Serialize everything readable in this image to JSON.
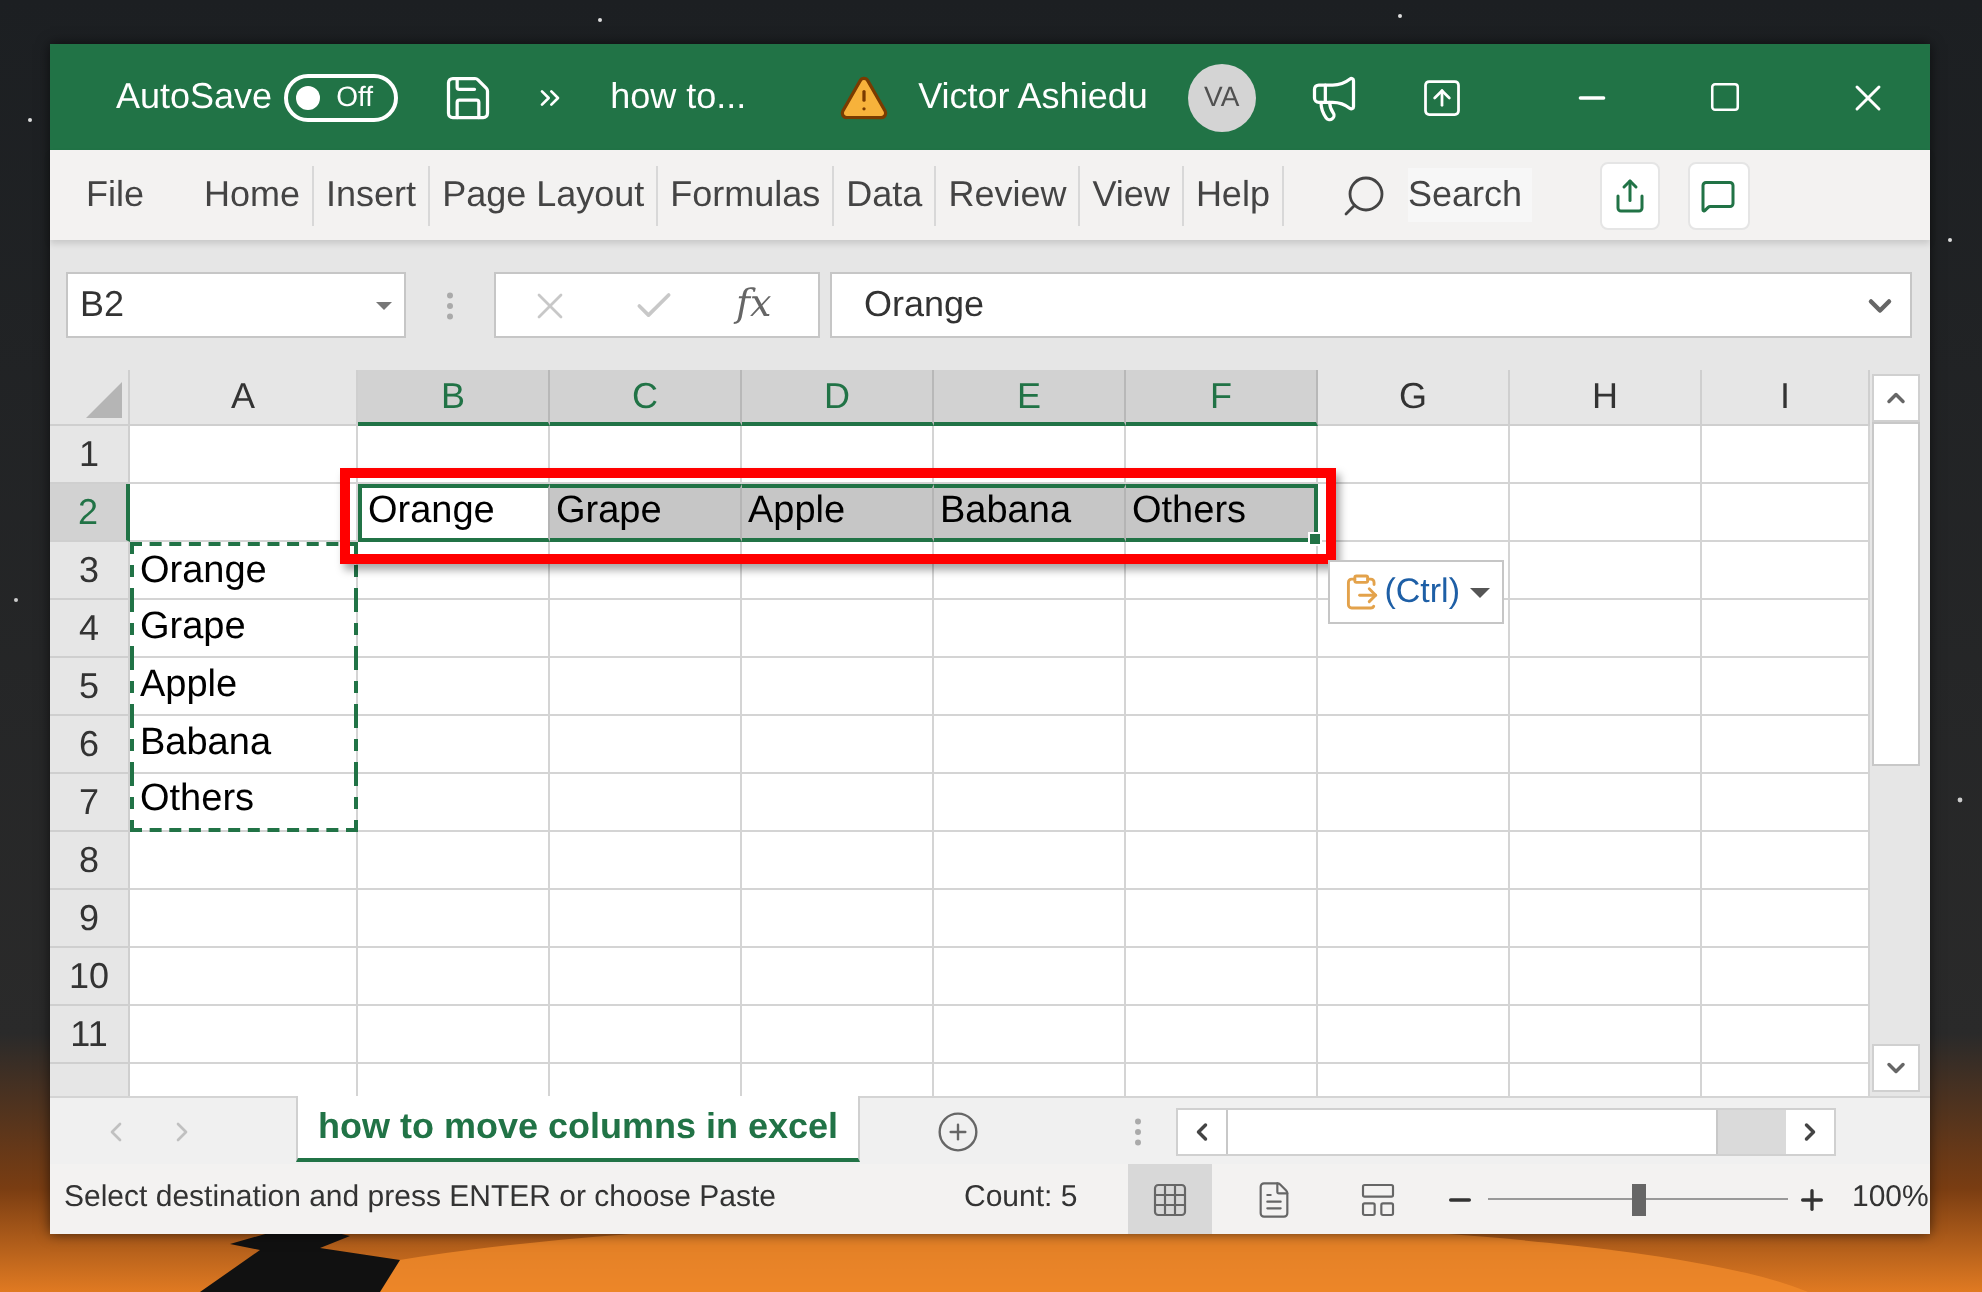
{
  "title_bar": {
    "autosave": {
      "label": "AutoSave",
      "state_label": "Off",
      "on": false
    },
    "document_title": "how to...",
    "user": {
      "name": "Victor Ashiedu",
      "initials": "VA"
    }
  },
  "ribbon_tabs": [
    "File",
    "Home",
    "Insert",
    "Page Layout",
    "Formulas",
    "Data",
    "Review",
    "View",
    "Help"
  ],
  "search": {
    "placeholder": "Search"
  },
  "formula_bar": {
    "name_box": "B2",
    "function_label": "fx",
    "value": "Orange"
  },
  "sheet": {
    "columns": [
      {
        "label": "A",
        "selected": false
      },
      {
        "label": "B",
        "selected": true
      },
      {
        "label": "C",
        "selected": true
      },
      {
        "label": "D",
        "selected": true
      },
      {
        "label": "E",
        "selected": true
      },
      {
        "label": "F",
        "selected": true
      },
      {
        "label": "G",
        "selected": false
      },
      {
        "label": "H",
        "selected": false
      },
      {
        "label": "I",
        "selected": false
      }
    ],
    "rows": [
      {
        "label": "1",
        "selected": false,
        "cells": {}
      },
      {
        "label": "2",
        "selected": true,
        "cells": {
          "B": {
            "text": "Orange",
            "selected": true,
            "active": true
          },
          "C": {
            "text": "Grape",
            "selected": true,
            "active": false
          },
          "D": {
            "text": "Apple",
            "selected": true,
            "active": false
          },
          "E": {
            "text": "Babana",
            "selected": true,
            "active": false
          },
          "F": {
            "text": "Others",
            "selected": true,
            "active": false
          }
        }
      },
      {
        "label": "3",
        "selected": false,
        "cells": {
          "A": {
            "text": "Orange",
            "copied": true
          }
        }
      },
      {
        "label": "4",
        "selected": false,
        "cells": {
          "A": {
            "text": "Grape",
            "copied": true
          }
        }
      },
      {
        "label": "5",
        "selected": false,
        "cells": {
          "A": {
            "text": "Apple",
            "copied": true
          }
        }
      },
      {
        "label": "6",
        "selected": false,
        "cells": {
          "A": {
            "text": "Babana",
            "copied": true
          }
        }
      },
      {
        "label": "7",
        "selected": false,
        "cells": {
          "A": {
            "text": "Others",
            "copied": true
          }
        }
      },
      {
        "label": "8",
        "selected": false,
        "cells": {}
      },
      {
        "label": "9",
        "selected": false,
        "cells": {}
      },
      {
        "label": "10",
        "selected": false,
        "cells": {}
      },
      {
        "label": "11",
        "selected": false,
        "cells": {}
      }
    ]
  },
  "paste_options": {
    "label": "(Ctrl)"
  },
  "sheet_tabs": [
    {
      "label": "how to move columns in excel",
      "selected": true
    }
  ],
  "status_bar": {
    "message": "Select destination and press ENTER or choose Paste",
    "count": "Count: 5",
    "views": [
      {
        "kind": "normal",
        "selected": true
      },
      {
        "kind": "page_layout",
        "selected": false
      },
      {
        "kind": "page_break",
        "selected": false
      }
    ],
    "zoom": {
      "level": 0.5,
      "reading": "100%"
    }
  }
}
